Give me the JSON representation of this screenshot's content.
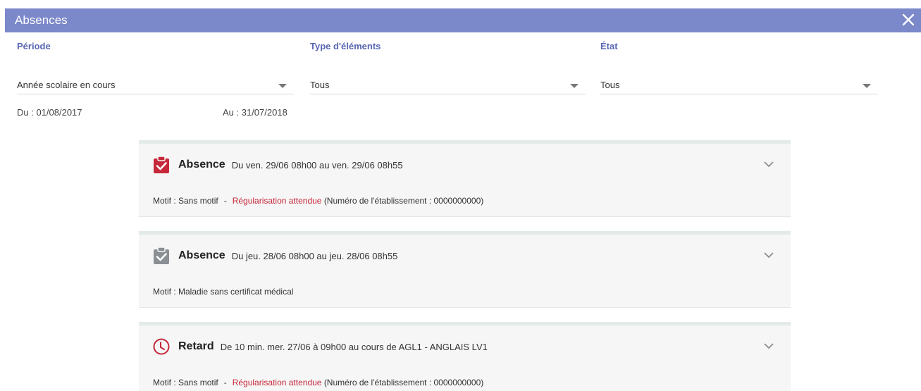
{
  "window": {
    "title": "Absences"
  },
  "filters": {
    "periode": {
      "label": "Période",
      "value": "Année scolaire en cours"
    },
    "type": {
      "label": "Type d'éléments",
      "value": "Tous"
    },
    "etat": {
      "label": "État",
      "value": "Tous"
    },
    "du": "Du : 01/08/2017",
    "au": "Au : 31/07/2018"
  },
  "items": [
    {
      "kind": "Absence",
      "when": "Du ven. 29/06 08h00 au ven. 29/06 08h55",
      "icon": "clipboard-check-red-icon",
      "motif": "Motif : Sans motif",
      "separator": "-",
      "regularisation": "Régularisation attendue",
      "note": "(Numéro de l'établissement : 0000000000)"
    },
    {
      "kind": "Absence",
      "when": "Du jeu. 28/06 08h00 au jeu. 28/06 08h55",
      "icon": "clipboard-check-gray-icon",
      "motif": "Motif : Maladie sans certificat médical"
    },
    {
      "kind": "Retard",
      "when": "De 10 min. mer. 27/06 à 09h00 au cours de AGL1 - ANGLAIS LV1",
      "icon": "clock-red-icon",
      "motif": "Motif : Sans motif",
      "separator": "-",
      "regularisation": "Régularisation attendue",
      "note": "(Numéro de l'établissement : 0000000000)"
    }
  ],
  "colors": {
    "accent": "#7b88c9",
    "label": "#5866b3",
    "alert": "#c6283a",
    "card_bg": "#f6f6f6"
  }
}
